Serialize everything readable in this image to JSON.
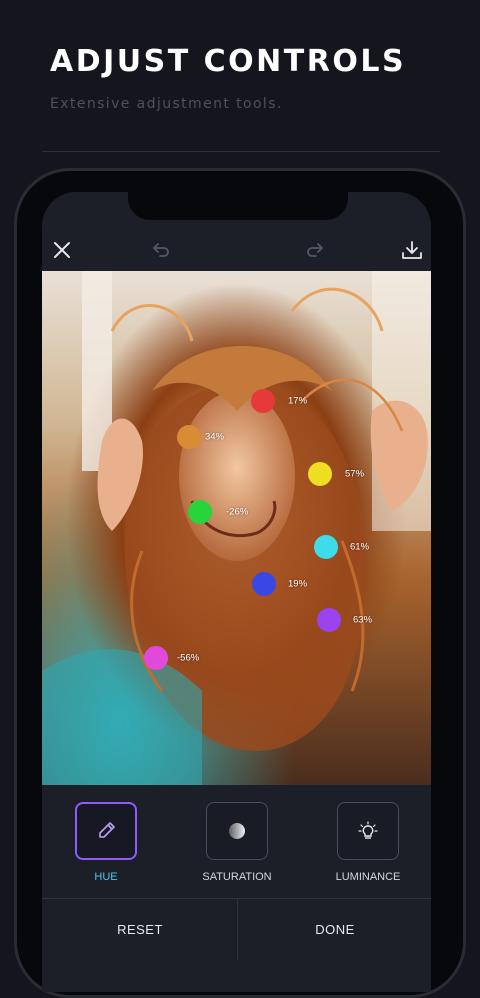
{
  "headline": "ADJUST CONTROLS",
  "subheadline": "Extensive adjustment tools.",
  "topbar": {
    "close_icon": "close-icon",
    "undo_icon": "undo-icon",
    "redo_icon": "redo-icon",
    "download_icon": "download-icon"
  },
  "color_points": [
    {
      "name": "red",
      "color": "#e5393a",
      "value": "17%"
    },
    {
      "name": "orange",
      "color": "#d98c34",
      "value": "34%"
    },
    {
      "name": "yellow",
      "color": "#eedd23",
      "value": "57%"
    },
    {
      "name": "green",
      "color": "#27d43a",
      "value": "-26%"
    },
    {
      "name": "cyan",
      "color": "#3edce8",
      "value": "61%"
    },
    {
      "name": "blue",
      "color": "#3b47e4",
      "value": "19%"
    },
    {
      "name": "purple",
      "color": "#9a43ef",
      "value": "63%"
    },
    {
      "name": "magenta",
      "color": "#e149db",
      "value": "-56%"
    }
  ],
  "tools": [
    {
      "label": "HUE",
      "icon": "brush-icon",
      "active": true
    },
    {
      "label": "SATURATION",
      "icon": "gradient-circle-icon",
      "active": false
    },
    {
      "label": "LUMINANCE",
      "icon": "lightbulb-icon",
      "active": false
    }
  ],
  "actions": {
    "reset": "RESET",
    "done": "DONE"
  },
  "colors": {
    "accent_border": "#8e5cf7",
    "accent_text": "#4cc5f3"
  }
}
